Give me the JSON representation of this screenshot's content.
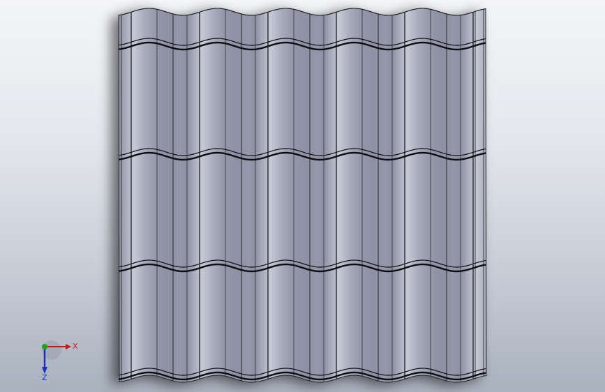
{
  "viewport": {
    "background_top": "#f4f5f7",
    "background_bottom": "#a9b1be"
  },
  "model": {
    "name": "roof-tile-panel",
    "tile_columns": 7,
    "tile_rows": 3,
    "surface_color": "#9a9eae",
    "highlight_color": "#c3c6d3",
    "shadow_color": "#80849a",
    "edge_color": "#111111"
  },
  "triad": {
    "x_label": "X",
    "z_label": "Z",
    "x_color": "#c41a1a",
    "y_color": "#1aa61a",
    "z_color": "#1a2fc4"
  }
}
